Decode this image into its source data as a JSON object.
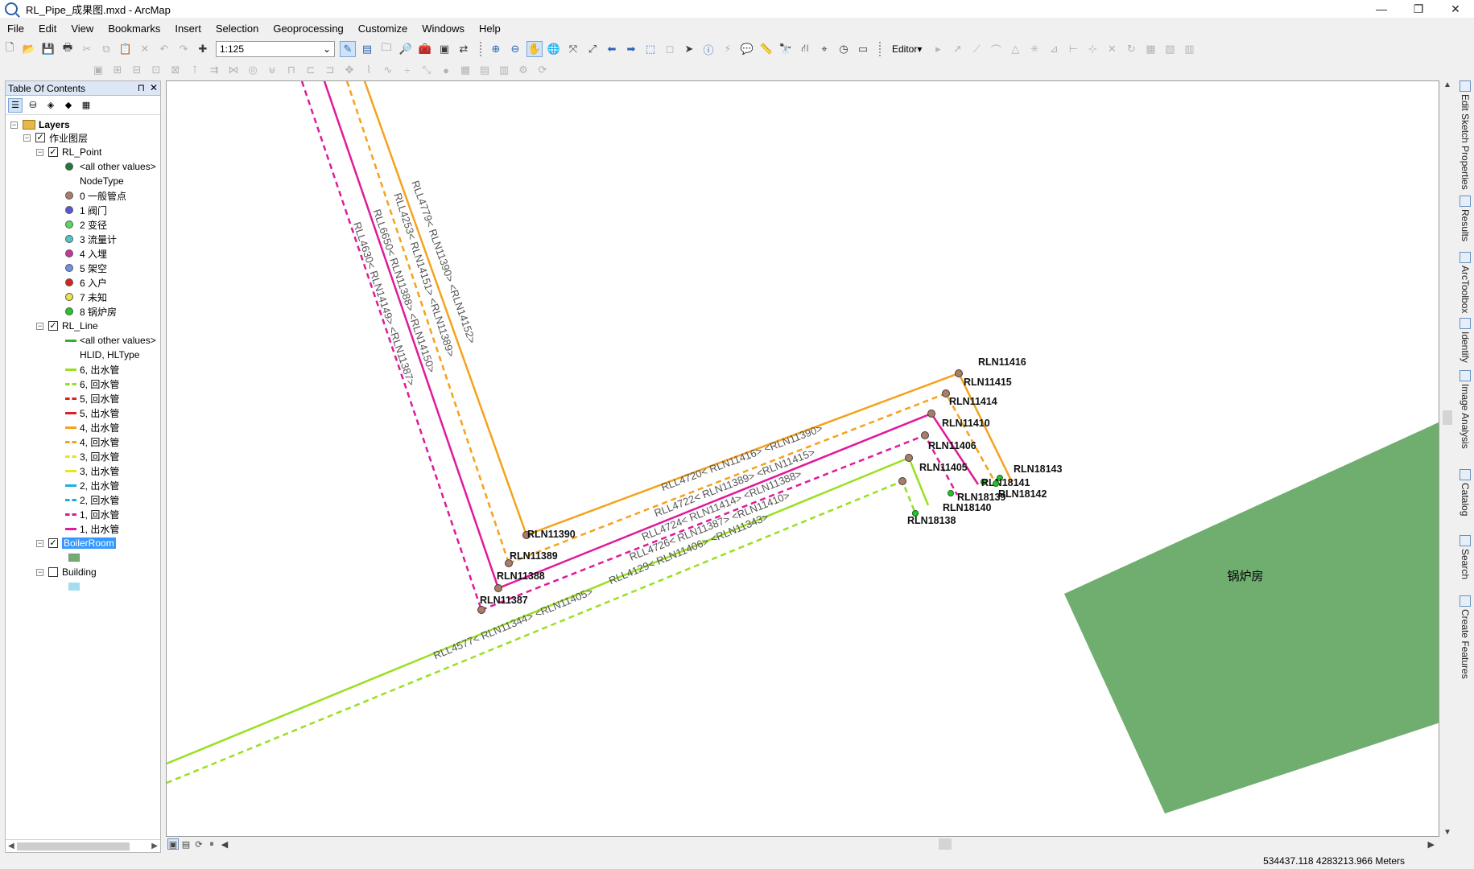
{
  "window": {
    "title": "RL_Pipe_成果图.mxd - ArcMap",
    "controls": [
      "—",
      "❐",
      "✕"
    ]
  },
  "menu": [
    "File",
    "Edit",
    "View",
    "Bookmarks",
    "Insert",
    "Selection",
    "Geoprocessing",
    "Customize",
    "Windows",
    "Help"
  ],
  "toolbar": {
    "scale": "1:125",
    "editor_label": "Editor▾"
  },
  "toc": {
    "title": "Table Of Contents",
    "pin": "⊓",
    "close": "✕",
    "root": "Layers",
    "group": "作业图层",
    "layers": [
      {
        "name": "RL_Point",
        "checked": true,
        "other_values": "<all other values>",
        "field": "NodeType",
        "legend": [
          {
            "label": "0 一般管点",
            "color": "#a87d6a"
          },
          {
            "label": "1 阀门",
            "color": "#5b55d6"
          },
          {
            "label": "2 变径",
            "color": "#58d95c"
          },
          {
            "label": "3 流量计",
            "color": "#4dc8c8"
          },
          {
            "label": "4 入埋",
            "color": "#c8359a"
          },
          {
            "label": "5 架空",
            "color": "#6f90e8"
          },
          {
            "label": "6 入户",
            "color": "#e02020"
          },
          {
            "label": "7 未知",
            "color": "#ece24a"
          },
          {
            "label": "8 锅炉房",
            "color": "#22c52a"
          }
        ],
        "other_color": "#1f7a3a"
      },
      {
        "name": "RL_Line",
        "checked": true,
        "other_values": "<all other values>",
        "field": "HLID, HLType",
        "legend": [
          {
            "label": "6, 出水管",
            "color": "#99e021",
            "dash": false
          },
          {
            "label": "6, 回水管",
            "color": "#99e021",
            "dash": true
          },
          {
            "label": "5, 回水管",
            "color": "#e02020",
            "dash": true
          },
          {
            "label": "5, 出水管",
            "color": "#e02020",
            "dash": false
          },
          {
            "label": "4, 出水管",
            "color": "#f5a21c",
            "dash": false
          },
          {
            "label": "4, 回水管",
            "color": "#f5a21c",
            "dash": true
          },
          {
            "label": "3, 回水管",
            "color": "#e6e61a",
            "dash": true
          },
          {
            "label": "3, 出水管",
            "color": "#e6e61a",
            "dash": false
          },
          {
            "label": "2, 出水管",
            "color": "#1aaee6",
            "dash": false
          },
          {
            "label": "2, 回水管",
            "color": "#1aaee6",
            "dash": true
          },
          {
            "label": "1, 回水管",
            "color": "#e01a9a",
            "dash": true
          },
          {
            "label": "1, 出水管",
            "color": "#e01a9a",
            "dash": false
          }
        ],
        "other_color": "#2fb12f"
      },
      {
        "name": "BoilerRoom",
        "checked": true,
        "color": "#6fae6f"
      },
      {
        "name": "Building",
        "checked": false,
        "color": "#a6dcef"
      }
    ]
  },
  "map": {
    "boiler_room_label": "锅炉房",
    "nodes": [
      {
        "id": "RLN11416",
        "type": "brown"
      },
      {
        "id": "RLN11415",
        "type": "brown"
      },
      {
        "id": "RLN11414",
        "type": "brown"
      },
      {
        "id": "RLN11410",
        "type": "brown"
      },
      {
        "id": "RLN11406",
        "type": "brown"
      },
      {
        "id": "RLN11405",
        "type": "brown"
      },
      {
        "id": "RLN11390",
        "type": "brown"
      },
      {
        "id": "RLN11389",
        "type": "brown"
      },
      {
        "id": "RLN11388",
        "type": "brown"
      },
      {
        "id": "RLN11387",
        "type": "brown"
      },
      {
        "id": "RLN18143",
        "type": "green"
      },
      {
        "id": "RLN18141",
        "type": "green"
      },
      {
        "id": "RLN18142",
        "type": "green"
      },
      {
        "id": "RLN18139",
        "type": "green"
      },
      {
        "id": "RLN18140",
        "type": "green"
      },
      {
        "id": "RLN18138",
        "type": "green"
      }
    ],
    "line_labels": {
      "l4779": "RLL4779< RLN11390> <RLN14152>",
      "l4253": "RLL4253< RLN14151> <RLN11389>",
      "l6650": "RLL6650< RLN11388> <RLN14150>",
      "l4630": "RLL4630< RLN14149> <RLN11387>",
      "l4720": "RLL4720< RLN11416> <RLN11390>",
      "l4722": "RLL4722< RLN11389> <RLN11415>",
      "l4724": "RLL4724< RLN11414> <RLN11388>",
      "l4726": "RLL4726< RLN11387> <RLN11410>",
      "l4129": "RLL4129< RLN11406> <RLN11343>",
      "l4577": "RLL4577< RLN11344> <RLN11405>"
    }
  },
  "right_dock": [
    "Edit Sketch Properties",
    "Results",
    "ArcToolbox",
    "Identify",
    "Image Analysis",
    "Catalog",
    "Search",
    "Create Features"
  ],
  "status": {
    "coords": "534437.118  4283213.966 Meters"
  }
}
